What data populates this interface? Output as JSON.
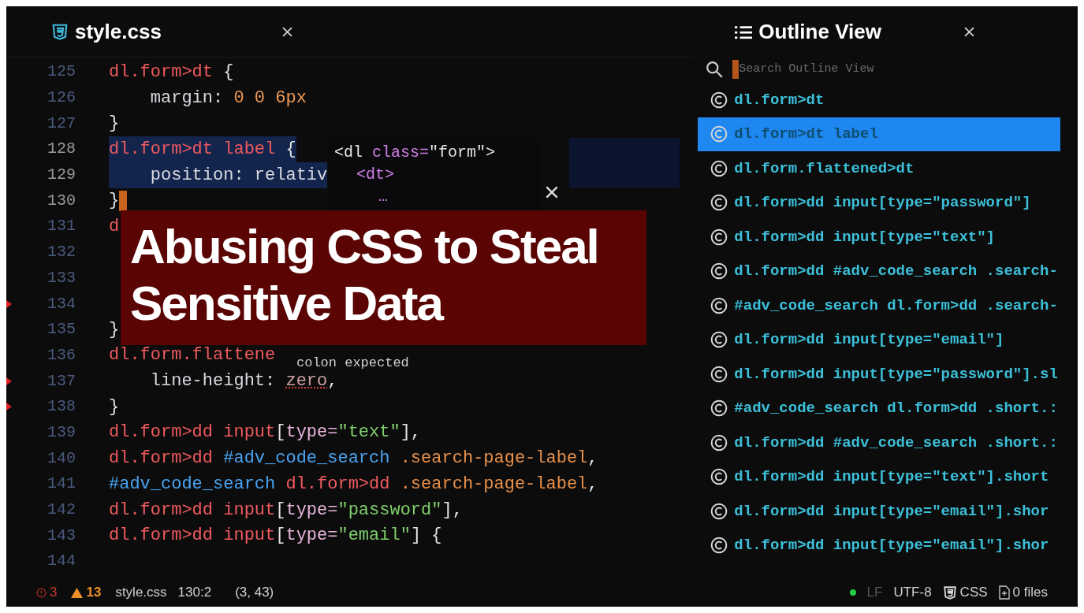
{
  "editor": {
    "tab": {
      "title": "style.css",
      "selected": true
    },
    "lines": [
      {
        "number": "125",
        "selected": false,
        "cursor": false,
        "error": false,
        "tokens": [
          {
            "kind": "sel",
            "text": "dl.form>dt "
          },
          {
            "kind": "p",
            "text": "{"
          }
        ]
      },
      {
        "number": "126",
        "selected": false,
        "cursor": false,
        "error": false,
        "tokens": [
          {
            "kind": "prop",
            "text": "    margin: "
          },
          {
            "kind": "num",
            "text": "0 0 6px"
          }
        ]
      },
      {
        "number": "127",
        "selected": false,
        "cursor": false,
        "error": false,
        "tokens": [
          {
            "kind": "p",
            "text": "}"
          }
        ]
      },
      {
        "number": "128",
        "selected": true,
        "cursor": false,
        "error": false,
        "tokens": [
          {
            "kind": "sel",
            "text": "dl.form>dt label "
          },
          {
            "kind": "p",
            "text": "{"
          }
        ]
      },
      {
        "number": "129",
        "selected": true,
        "cursor": false,
        "error": false,
        "tokens": [
          {
            "kind": "prop",
            "text": "    position: relativ"
          }
        ]
      },
      {
        "number": "130",
        "selected": false,
        "cursor": true,
        "error": false,
        "tokens": [
          {
            "kind": "p",
            "text": "}"
          }
        ]
      },
      {
        "number": "131",
        "selected": false,
        "cursor": false,
        "error": false,
        "tokens": [
          {
            "kind": "sel",
            "text": "d"
          }
        ]
      },
      {
        "number": "132",
        "selected": false,
        "cursor": false,
        "error": false
      },
      {
        "number": "133",
        "selected": false,
        "cursor": false,
        "error": false
      },
      {
        "number": "134",
        "selected": false,
        "cursor": false,
        "error": true
      },
      {
        "number": "135",
        "selected": false,
        "cursor": false,
        "error": false,
        "tokens": [
          {
            "kind": "p",
            "text": "}"
          }
        ]
      },
      {
        "number": "136",
        "selected": false,
        "cursor": false,
        "error": false,
        "tokens": [
          {
            "kind": "sel",
            "text": "dl.form.flattene"
          }
        ]
      },
      {
        "number": "137",
        "selected": false,
        "cursor": false,
        "error": true,
        "tokens": [
          {
            "kind": "prop",
            "text": "    line-height: "
          },
          {
            "kind": "bad",
            "text": "zero"
          },
          {
            "kind": "p",
            "text": ","
          }
        ]
      },
      {
        "number": "138",
        "selected": false,
        "cursor": false,
        "error": true,
        "tokens": [
          {
            "kind": "p",
            "text": "}"
          }
        ]
      },
      {
        "number": "139",
        "selected": false,
        "cursor": false,
        "error": false,
        "tokens": [
          {
            "kind": "sel",
            "text": "dl.form>dd input"
          },
          {
            "kind": "p",
            "text": "["
          },
          {
            "kind": "attr",
            "text": "type="
          },
          {
            "kind": "str",
            "text": "\"text\""
          },
          {
            "kind": "p",
            "text": "],"
          }
        ]
      },
      {
        "number": "140",
        "selected": false,
        "cursor": false,
        "error": false,
        "tokens": [
          {
            "kind": "sel",
            "text": "dl.form>dd "
          },
          {
            "kind": "id",
            "text": "#adv_code_search "
          },
          {
            "kind": "cls",
            "text": ".search-page-label"
          },
          {
            "kind": "p",
            "text": ","
          }
        ]
      },
      {
        "number": "141",
        "selected": false,
        "cursor": false,
        "error": false,
        "tokens": [
          {
            "kind": "id",
            "text": "#adv_code_search "
          },
          {
            "kind": "sel",
            "text": "dl.form>dd "
          },
          {
            "kind": "cls",
            "text": ".search-page-label"
          },
          {
            "kind": "p",
            "text": ","
          }
        ]
      },
      {
        "number": "142",
        "selected": false,
        "cursor": false,
        "error": false,
        "tokens": [
          {
            "kind": "sel",
            "text": "dl.form>dd input"
          },
          {
            "kind": "p",
            "text": "["
          },
          {
            "kind": "attr",
            "text": "type="
          },
          {
            "kind": "str",
            "text": "\"password\""
          },
          {
            "kind": "p",
            "text": "],"
          }
        ]
      },
      {
        "number": "143",
        "selected": false,
        "cursor": false,
        "error": false,
        "tokens": [
          {
            "kind": "sel",
            "text": "dl.form>dd input"
          },
          {
            "kind": "p",
            "text": "["
          },
          {
            "kind": "attr",
            "text": "type="
          },
          {
            "kind": "str",
            "text": "\"email\""
          },
          {
            "kind": "p",
            "text": "] {"
          }
        ]
      },
      {
        "number": "144",
        "selected": false,
        "cursor": false,
        "error": false
      }
    ],
    "preview_popup": {
      "lines": [
        [
          {
            "kind": "p",
            "text": "<dl "
          },
          {
            "kind": "attr2",
            "text": "class="
          },
          {
            "kind": "p",
            "text": "\"form\">"
          }
        ],
        [
          {
            "kind": "attr2",
            "text": "<dt>"
          }
        ],
        [
          {
            "kind": "attr2",
            "text": "…"
          }
        ]
      ]
    },
    "hint_tooltip": "colon expected",
    "banner": "Abusing CSS to Steal Sensitive Data"
  },
  "outline": {
    "title": "Outline View",
    "search": {
      "placeholder": "Search Outline View"
    },
    "items": [
      {
        "label": "dl.form>dt",
        "selected": false
      },
      {
        "label": "dl.form>dt label",
        "selected": true
      },
      {
        "label": "dl.form.flattened>dt",
        "selected": false
      },
      {
        "label": "dl.form>dd input[type=\"password\"]",
        "selected": false
      },
      {
        "label": "dl.form>dd input[type=\"text\"]",
        "selected": false
      },
      {
        "label": "dl.form>dd #adv_code_search .search-",
        "selected": false
      },
      {
        "label": "#adv_code_search dl.form>dd .search-",
        "selected": false
      },
      {
        "label": "dl.form>dd input[type=\"email\"]",
        "selected": false
      },
      {
        "label": "dl.form>dd input[type=\"password\"].sl",
        "selected": false
      },
      {
        "label": "#adv_code_search dl.form>dd .short.:",
        "selected": false
      },
      {
        "label": "dl.form>dd #adv_code_search .short.:",
        "selected": false
      },
      {
        "label": "dl.form>dd input[type=\"text\"].short",
        "selected": false
      },
      {
        "label": "dl.form>dd input[type=\"email\"].shor",
        "selected": false
      },
      {
        "label": "dl.form>dd input[type=\"email\"].shor",
        "selected": false
      }
    ]
  },
  "status_bar": {
    "errors": "3",
    "warnings": "13",
    "file": "style.css",
    "position": "130:2",
    "selection": "(3, 43)",
    "line_ending": "LF",
    "encoding": "UTF-8",
    "grammar": "CSS",
    "files": "0 files"
  }
}
